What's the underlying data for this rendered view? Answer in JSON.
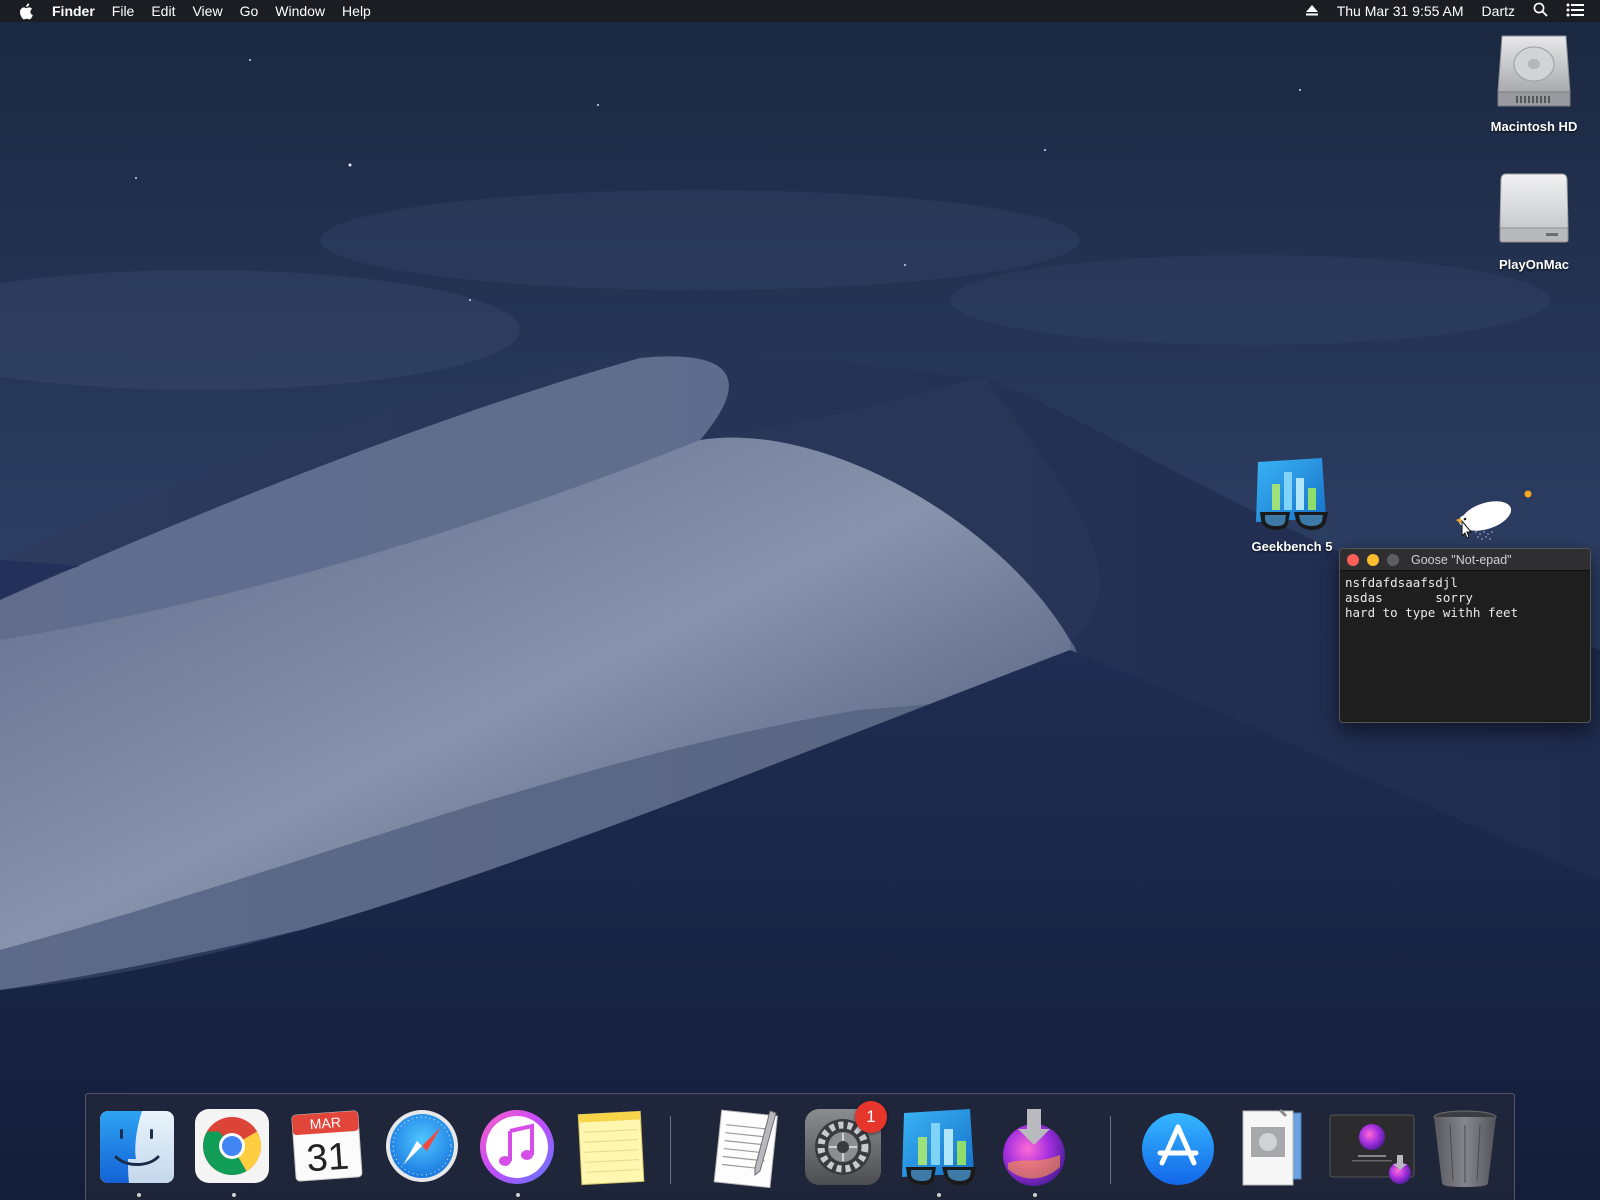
{
  "menubar": {
    "app_name": "Finder",
    "menus": [
      "File",
      "Edit",
      "View",
      "Go",
      "Window",
      "Help"
    ],
    "clock": "Thu Mar 31  9:55 AM",
    "user": "Dartz"
  },
  "desktop": {
    "icons": [
      {
        "label": "Macintosh HD",
        "icon": "hard-drive-icon"
      },
      {
        "label": "PlayOnMac",
        "icon": "external-drive-icon"
      },
      {
        "label": "Geekbench 5",
        "icon": "geekbench-icon"
      }
    ]
  },
  "notepad": {
    "title": "Goose \"Not-epad\"",
    "text": "nsfdafdsaafsdjl\nasdas       sorry\nhard to type withh feet"
  },
  "calendar": {
    "month": "MAR",
    "day": "31"
  },
  "dock": {
    "items": [
      "Finder",
      "Google Chrome",
      "Calendar",
      "Safari",
      "iTunes",
      "Notes",
      "TextEdit",
      "System Preferences",
      "Geekbench 5",
      "Install macOS Monterey",
      "App Store",
      "Preview",
      "macOS Monterey",
      "Trash"
    ],
    "system_prefs_badge": "1"
  },
  "colors": {
    "menubar": "#1c1c20",
    "dock_bg": "#282c38",
    "badge": "#e6352b"
  }
}
